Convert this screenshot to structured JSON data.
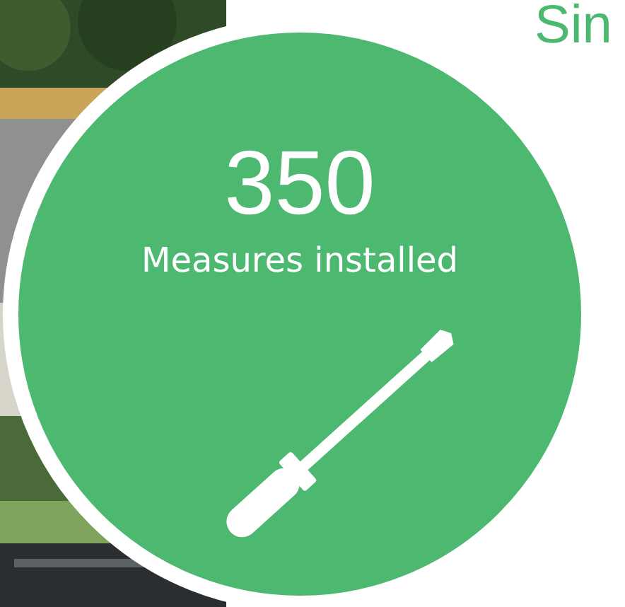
{
  "heading": "Sin",
  "stat": {
    "value": "350",
    "label": "Measures installed"
  }
}
